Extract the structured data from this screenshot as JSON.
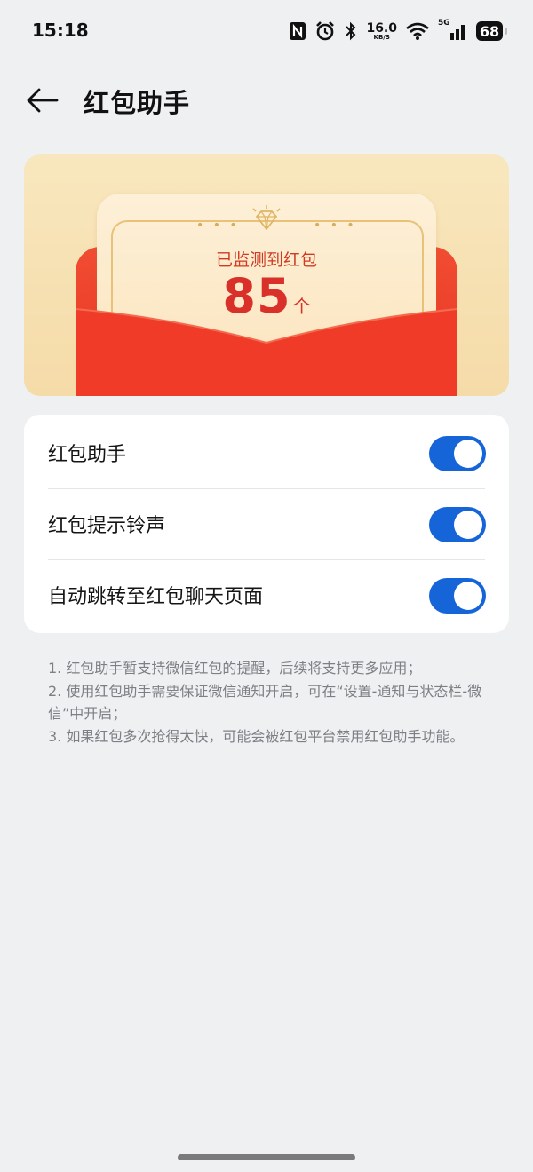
{
  "status_bar": {
    "time": "15:18",
    "net_speed_value": "16.0",
    "net_speed_unit": "KB/S",
    "network_type": "5G",
    "battery": "68",
    "icons": [
      "nfc-icon",
      "alarm-icon",
      "bluetooth-icon",
      "wifi-icon",
      "signal-icon",
      "battery-icon"
    ]
  },
  "header": {
    "back_icon": "arrow-left-icon",
    "title": "红包助手"
  },
  "banner": {
    "detected_label": "已监测到红包",
    "count": "85",
    "count_unit": "个",
    "colors": {
      "envelope_red": "#e7311f",
      "card_cream": "#fdf0d8",
      "banner_bg": "#f8e7be"
    }
  },
  "settings": [
    {
      "label": "红包助手",
      "enabled": true
    },
    {
      "label": "红包提示铃声",
      "enabled": true
    },
    {
      "label": "自动跳转至红包聊天页面",
      "enabled": true
    }
  ],
  "notes": [
    "1. 红包助手暂支持微信红包的提醒，后续将支持更多应用；",
    "2. 使用红包助手需要保证微信通知开启，可在“设置-通知与状态栏-微信”中开启；",
    "3. 如果红包多次抢得太快，可能会被红包平台禁用红包助手功能。"
  ],
  "accent_color": "#1565d8"
}
